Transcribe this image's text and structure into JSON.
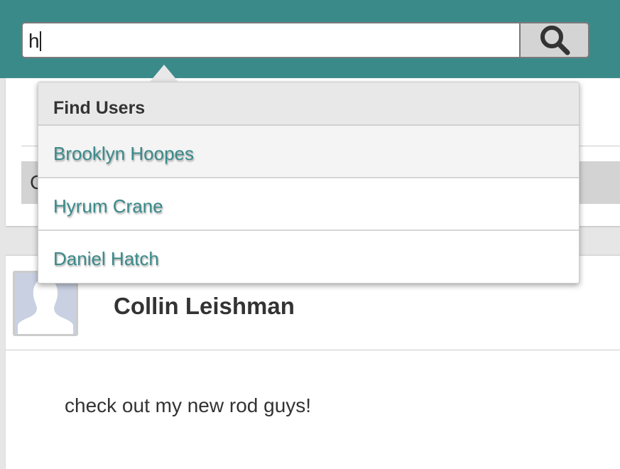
{
  "search": {
    "value": "h",
    "button_icon": "search-icon"
  },
  "dropdown": {
    "header": "Find Users",
    "users": [
      {
        "name": "Brooklyn Hoopes"
      },
      {
        "name": "Hyrum Crane"
      },
      {
        "name": "Daniel Hatch"
      }
    ]
  },
  "feed": {
    "gray_bar_label": "C",
    "post": {
      "author": "Collin Leishman",
      "text": "check out my new rod guys!"
    }
  },
  "colors": {
    "brand": "#3b8a8a"
  }
}
